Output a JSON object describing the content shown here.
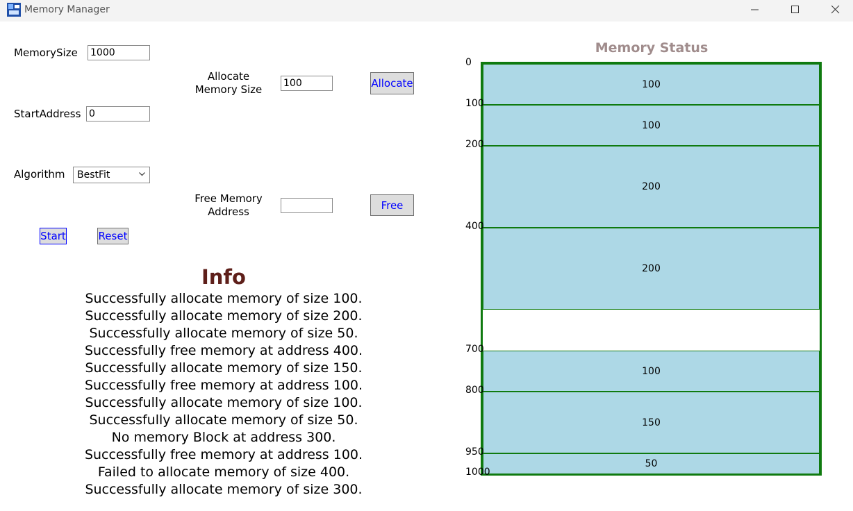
{
  "window": {
    "title": "Memory Manager"
  },
  "config": {
    "memory_size_label": "MemorySize",
    "memory_size_value": "1000",
    "start_address_label": "StartAddress",
    "start_address_value": "0",
    "algorithm_label": "Algorithm",
    "algorithm_value": "BestFit"
  },
  "allocate": {
    "label_line1": "Allocate",
    "label_line2": "Memory Size",
    "value": "100",
    "button": "Allocate"
  },
  "free": {
    "label_line1": "Free Memory",
    "label_line2": "Address",
    "value": "",
    "button": "Free"
  },
  "controls": {
    "start": "Start",
    "reset": "Reset"
  },
  "info": {
    "title": "Info",
    "messages": [
      "Successfully allocate memory of size 100.",
      "Successfully allocate memory of size 200.",
      "Successfully allocate memory of size 50.",
      "Successfully free memory at address 400.",
      "Successfully allocate memory of size 150.",
      "Successfully free memory at address 100.",
      "Successfully allocate memory of size 100.",
      "Successfully allocate memory of size 50.",
      "No memory Block at address 300.",
      "Successfully free memory at address 100.",
      "Failed to allocate memory of size 400.",
      "Successfully allocate memory of size 300."
    ]
  },
  "memory_status": {
    "title": "Memory Status",
    "total": 1000,
    "blocks": [
      {
        "start": 0,
        "size": 100,
        "label": "100"
      },
      {
        "start": 100,
        "size": 100,
        "label": "100"
      },
      {
        "start": 200,
        "size": 200,
        "label": "200"
      },
      {
        "start": 400,
        "size": 200,
        "label": "200"
      },
      {
        "start": 700,
        "size": 100,
        "label": "100"
      },
      {
        "start": 800,
        "size": 150,
        "label": "150"
      },
      {
        "start": 950,
        "size": 50,
        "label": "50"
      }
    ],
    "address_labels": [
      "0",
      "100",
      "200",
      "400",
      "700",
      "800",
      "950",
      "1000"
    ]
  },
  "colors": {
    "block_fill": "#add8e6",
    "block_border": "#0f7a0f",
    "info_title": "#5e1f1a",
    "memory_title": "#a08c8c",
    "button_text": "#0000ff"
  }
}
